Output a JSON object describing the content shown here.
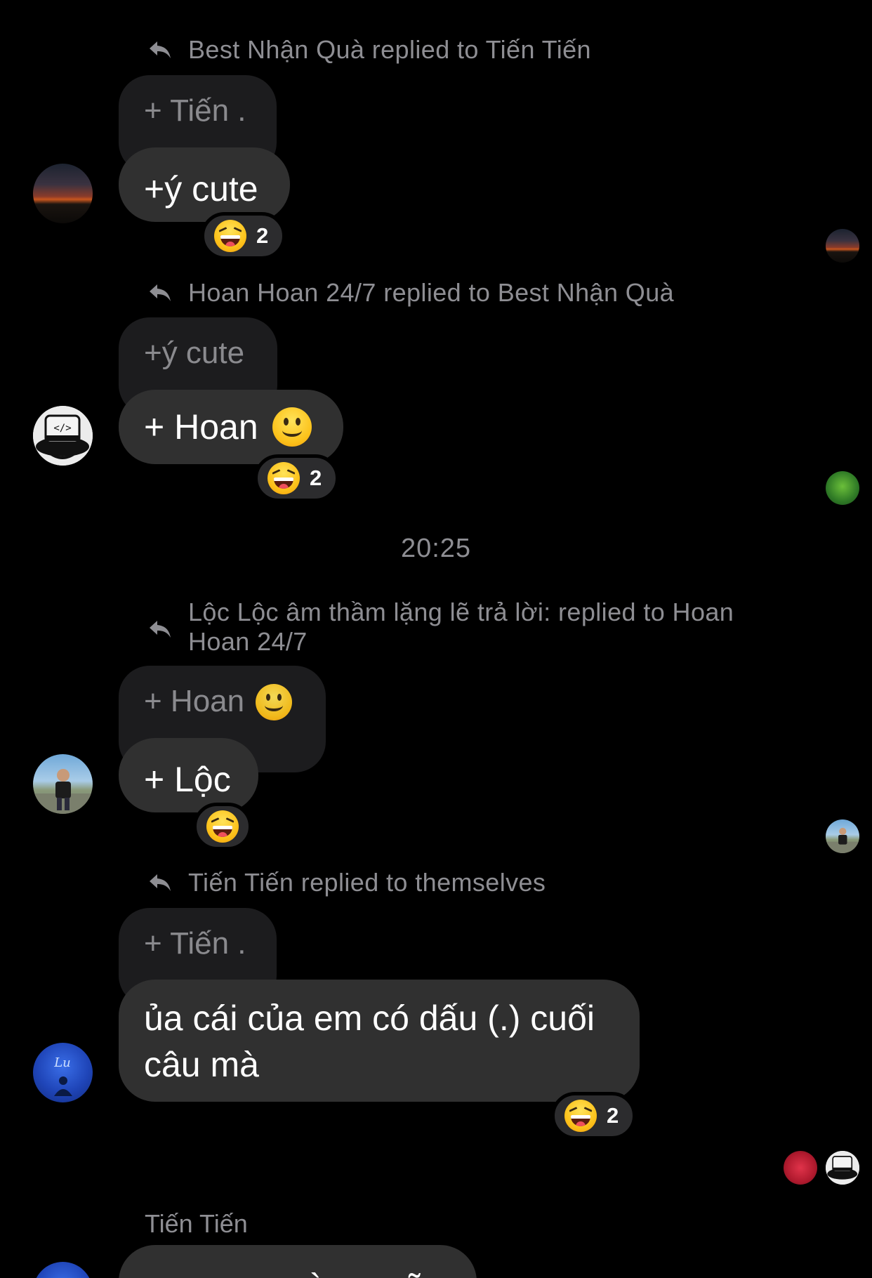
{
  "colors": {
    "background": "#000000",
    "bubble": "#303030",
    "quote_bubble": "#1c1c1e",
    "muted_text": "#8e8e93"
  },
  "messages": [
    {
      "reply_header": "Best Nhận Quà replied to Tiến Tiến",
      "quoted": "+ Tiến .",
      "text": "+ý cute",
      "reaction": {
        "emoji": "laughing-face",
        "count": "2"
      },
      "avatar": "sunset-avatar",
      "read_receipt": "sunset-avatar"
    },
    {
      "reply_header": "Hoan Hoan 24/7 replied to Best Nhận Quà",
      "quoted": "+ý cute",
      "text": "+ Hoan",
      "reaction": {
        "emoji": "laughing-face",
        "count": "2"
      },
      "avatar": "code-hat-avatar",
      "read_receipt": "green-avatar"
    },
    {
      "timestamp": "20:25"
    },
    {
      "reply_header": "Lộc Lộc âm thầm lặng lẽ trả lời: replied to Hoan Hoan 24/7",
      "quoted": "+ Hoan",
      "text": "+ Lộc",
      "reaction": {
        "emoji": "laughing-face",
        "count": ""
      },
      "avatar": "person-avatar",
      "read_receipt": "person-avatar"
    },
    {
      "reply_header": "Tiến Tiến replied to themselves",
      "quoted": "+ Tiến .",
      "text": "ủa cái của em có dấu (.) cuối câu mà",
      "reaction": {
        "emoji": "laughing-face",
        "count": "2"
      },
      "avatar": "blue-avatar",
      "read_receipts": [
        "red-avatar",
        "code-hat-avatar"
      ]
    },
    {
      "sender": "Tiến Tiến",
      "text_partial": "sao mng còn + nữa"
    }
  ]
}
